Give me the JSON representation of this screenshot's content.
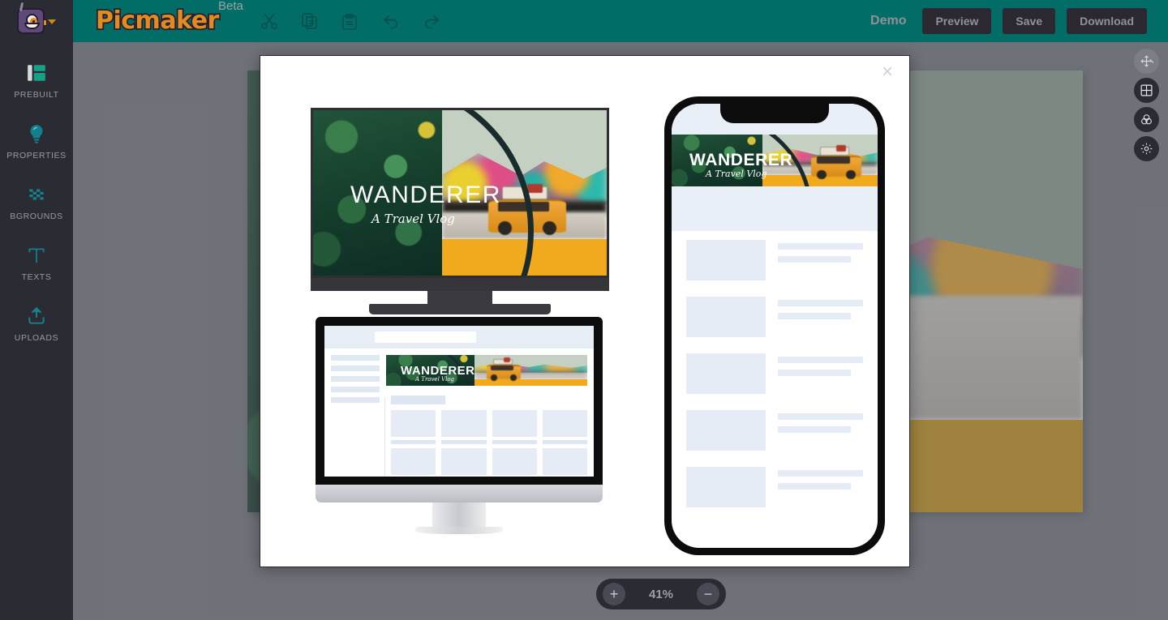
{
  "app": {
    "name": "Picmaker",
    "badge": "Beta",
    "avatar_icon": "robot-avatar-icon",
    "account_chevron_icon": "chevron-down-icon"
  },
  "header": {
    "tools": [
      {
        "name": "cut-icon",
        "label": "Cut"
      },
      {
        "name": "copy-icon",
        "label": "Copy"
      },
      {
        "name": "paste-icon",
        "label": "Paste"
      },
      {
        "name": "undo-icon",
        "label": "Undo"
      },
      {
        "name": "redo-icon",
        "label": "Redo"
      }
    ],
    "project_name": "Demo",
    "preview_label": "Preview",
    "save_label": "Save",
    "download_label": "Download"
  },
  "sidebar": {
    "items": [
      {
        "label": "PREBUILT",
        "icon": "layout-grid-icon"
      },
      {
        "label": "PROPERTIES",
        "icon": "lightbulb-icon"
      },
      {
        "label": "BGROUNDS",
        "icon": "checkerboard-icon"
      },
      {
        "label": "TEXTS",
        "icon": "text-t-icon"
      },
      {
        "label": "UPLOADS",
        "icon": "upload-icon"
      }
    ]
  },
  "right_rail": {
    "items": [
      {
        "name": "move-tool-icon",
        "label": "Move",
        "active": true
      },
      {
        "name": "grid-tool-icon",
        "label": "Grid",
        "active": false
      },
      {
        "name": "color-palette-icon",
        "label": "Colors",
        "active": false
      },
      {
        "name": "settings-gear-icon",
        "label": "Settings",
        "active": false
      }
    ]
  },
  "modal": {
    "close_icon": "close-icon",
    "close_label": "×",
    "mockups": [
      {
        "name": "tv-mockup",
        "device": "Television"
      },
      {
        "name": "desktop-mockup",
        "device": "Desktop Monitor"
      },
      {
        "name": "phone-mockup",
        "device": "Smartphone"
      }
    ]
  },
  "design": {
    "title": "WANDERER",
    "subtitle": "A Travel Vlog",
    "colors": {
      "accent_yellow": "#f1a91e",
      "forest_green": "#143c2b",
      "circle_dark": "#1a2b2c",
      "brand_teal": "#026c66",
      "brand_orange": "#e08c21"
    }
  },
  "zoom": {
    "value": "41%",
    "increase_label": "+",
    "decrease_label": "−"
  }
}
